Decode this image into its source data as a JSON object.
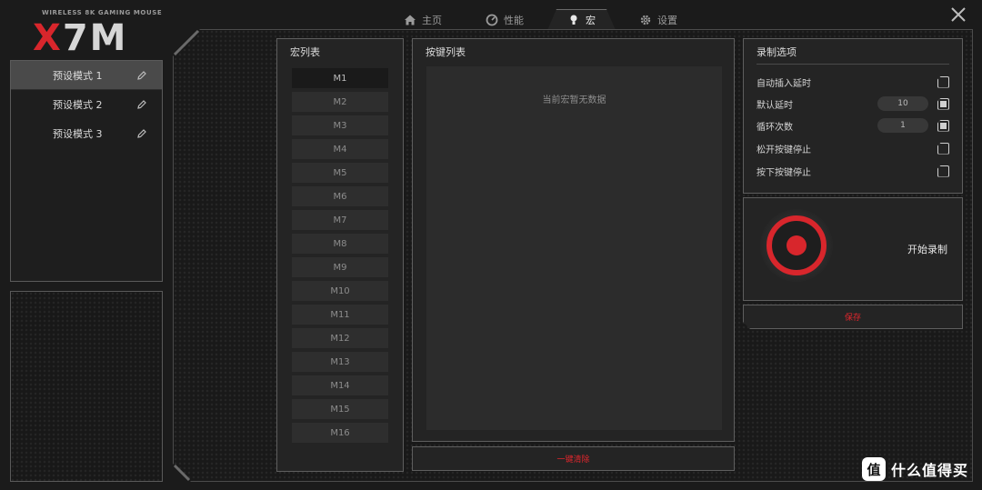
{
  "logo": {
    "subtitle": "WIRELESS 8K GAMING MOUSE",
    "mark_x": "X",
    "mark_rest": "7M"
  },
  "tabs": [
    {
      "label": "主页",
      "icon": "home-icon",
      "active": false
    },
    {
      "label": "性能",
      "icon": "gauge-icon",
      "active": false
    },
    {
      "label": "宏",
      "icon": "bulb-icon",
      "active": true
    },
    {
      "label": "设置",
      "icon": "gear-icon",
      "active": false
    }
  ],
  "presets": [
    {
      "label": "预设模式 1",
      "active": true
    },
    {
      "label": "预设模式 2",
      "active": false
    },
    {
      "label": "预设模式 3",
      "active": false
    }
  ],
  "macro_list": {
    "title": "宏列表",
    "items": [
      "M1",
      "M2",
      "M3",
      "M4",
      "M5",
      "M6",
      "M7",
      "M8",
      "M9",
      "M10",
      "M11",
      "M12",
      "M13",
      "M14",
      "M15",
      "M16"
    ],
    "selected": "M1"
  },
  "key_list": {
    "title": "按键列表",
    "empty_text": "当前宏暂无数据",
    "clear_label": "一键清除"
  },
  "record_options": {
    "title": "录制选项",
    "rows": [
      {
        "label": "自动插入延时",
        "value": null,
        "checked": false
      },
      {
        "label": "默认延时",
        "value": "10",
        "checked": true
      },
      {
        "label": "循环次数",
        "value": "1",
        "checked": true
      },
      {
        "label": "松开按键停止",
        "value": null,
        "checked": false
      },
      {
        "label": "按下按键停止",
        "value": null,
        "checked": false
      }
    ]
  },
  "record": {
    "label": "开始录制"
  },
  "save_label": "保存",
  "watermark": {
    "badge": "值",
    "text": "什么值得买"
  },
  "colors": {
    "accent": "#d8262c",
    "panel": "#242424",
    "border": "#5e5e5e"
  }
}
